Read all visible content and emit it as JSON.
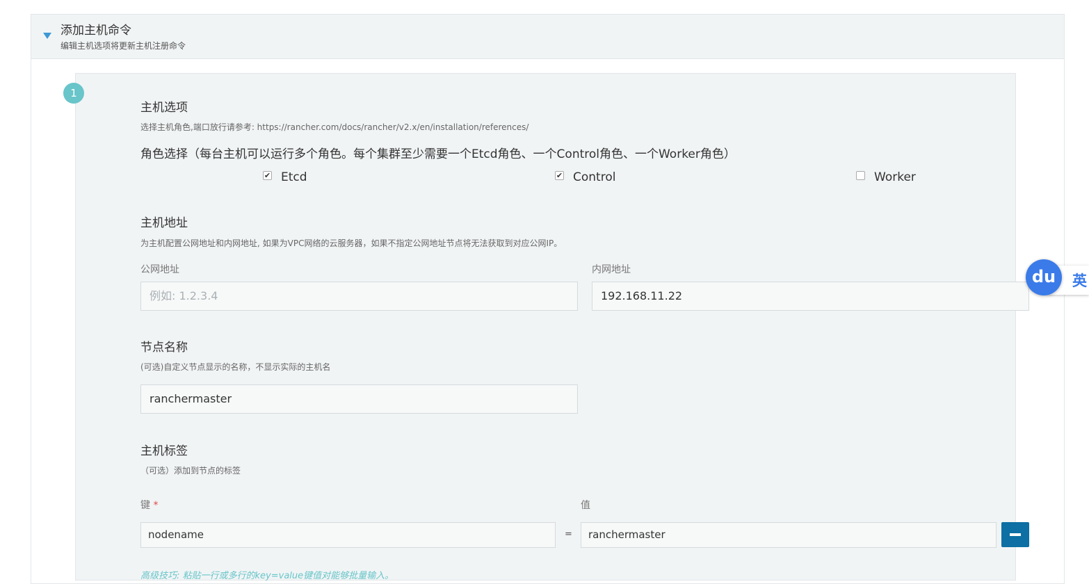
{
  "section": {
    "title": "添加主机命令",
    "subtitle": "编辑主机选项将更新主机注册命令"
  },
  "step": {
    "number": "1"
  },
  "host_options": {
    "title": "主机选项",
    "help": "选择主机角色,端口放行请参考: https://rancher.com/docs/rancher/v2.x/en/installation/references/",
    "roles_title": "角色选择（每台主机可以运行多个角色。每个集群至少需要一个Etcd角色、一个Control角色、一个Worker角色）",
    "roles": [
      {
        "label": "Etcd",
        "checked": true
      },
      {
        "label": "Control",
        "checked": true
      },
      {
        "label": "Worker",
        "checked": false
      }
    ]
  },
  "host_address": {
    "title": "主机地址",
    "help": "为主机配置公网地址和内网地址, 如果为VPC网络的云服务器，如果不指定公网地址节点将无法获取到对应公网IP。",
    "public_label": "公网地址",
    "public_placeholder": "例如: 1.2.3.4",
    "public_value": "",
    "internal_label": "内网地址",
    "internal_value": "192.168.11.22"
  },
  "node_name": {
    "title": "节点名称",
    "help": "(可选)自定义节点显示的名称，不显示实际的主机名",
    "value": "ranchermaster"
  },
  "host_labels": {
    "title": "主机标签",
    "help": "（可选）添加到节点的标签",
    "key_label": "键",
    "required_mark": "*",
    "value_label": "值",
    "key_value": "nodename",
    "equals": "=",
    "value_value": "ranchermaster",
    "tip": "高级技巧: 粘贴一行或多行的key=value键值对能够批量输入。"
  },
  "overlay": {
    "badge": "du",
    "tab_label": "英"
  },
  "colors": {
    "accent": "#3d98d3",
    "step_badge": "#68c5c9",
    "remove_button": "#0d6fa3",
    "required": "#e04a4a"
  }
}
